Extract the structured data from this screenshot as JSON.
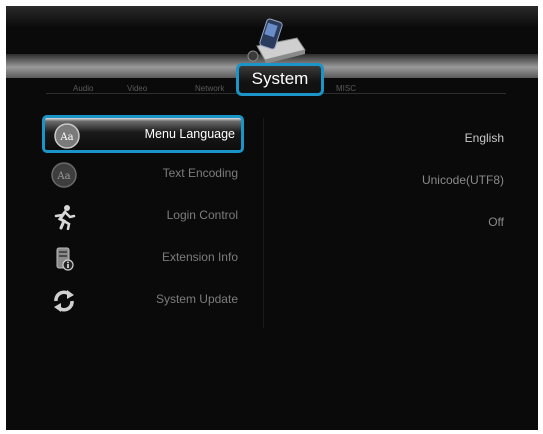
{
  "tabs": [
    {
      "label": "Audio"
    },
    {
      "label": "Video"
    },
    {
      "label": "Network"
    },
    {
      "label": "System"
    },
    {
      "label": "MISC"
    }
  ],
  "menu": [
    {
      "label": "Menu Language",
      "icon": "language-icon",
      "value": "English"
    },
    {
      "label": "Text Encoding",
      "icon": "text-encoding-icon",
      "value": "Unicode(UTF8)"
    },
    {
      "label": "Login Control",
      "icon": "running-person-icon",
      "value": "Off"
    },
    {
      "label": "Extension Info",
      "icon": "extension-info-icon",
      "value": ""
    },
    {
      "label": "System Update",
      "icon": "refresh-arrows-icon",
      "value": ""
    }
  ],
  "colors": {
    "highlight": "#1b95c8",
    "background": "#0a0a0a",
    "selected_text": "#ffffff",
    "dim_text": "#7c7c7c"
  }
}
